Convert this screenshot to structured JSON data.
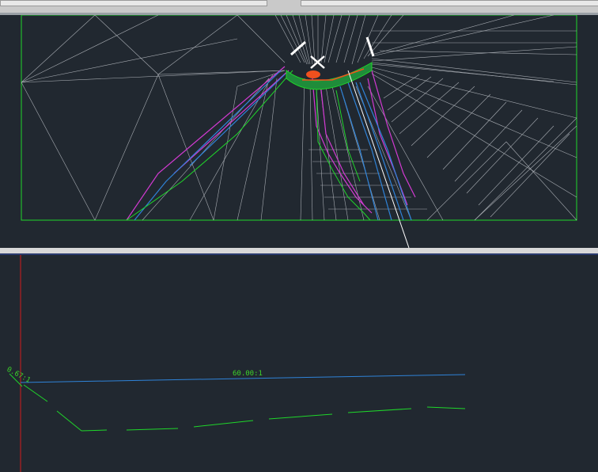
{
  "profile": {
    "grade_label_main": "60.00:1",
    "grade_label_side": "0.67:1"
  },
  "colors": {
    "background": "#212830",
    "mesh": "#c8ccd2",
    "boundary": "#1fd62a",
    "magenta": "#d23ad2",
    "blue": "#2f83d8",
    "red_axis": "#d21c1c",
    "orange": "#f0501e"
  }
}
